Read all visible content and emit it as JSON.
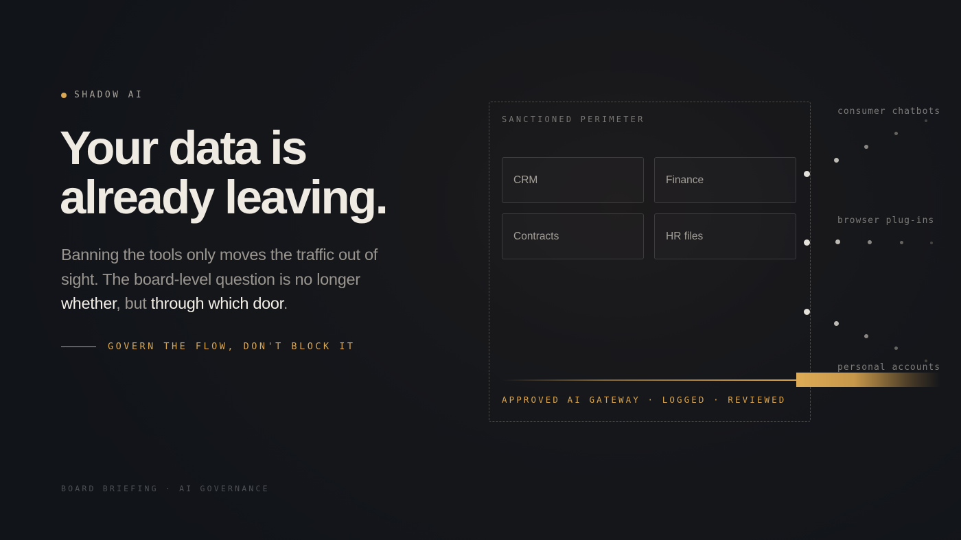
{
  "eyebrow": {
    "label": "SHADOW AI",
    "dot_color": "#d9a651"
  },
  "headline": {
    "line1": "Your data is",
    "line2": "already leaving."
  },
  "lede": {
    "part1": "Banning the tools only moves the traffic out of sight. The board-level question is no longer ",
    "emphasis1": "whether",
    "part2": ", but ",
    "emphasis2": "through which door",
    "part3": "."
  },
  "cta": {
    "label": "GOVERN THE FLOW, DON'T BLOCK IT"
  },
  "footer": {
    "label": "BOARD BRIEFING · AI GOVERNANCE"
  },
  "diagram": {
    "perimeter_label": "SANCTIONED PERIMETER",
    "systems": [
      "CRM",
      "Finance",
      "Contracts",
      "HR files"
    ],
    "gateway_label": "APPROVED AI GATEWAY · LOGGED · REVIEWED",
    "leak_channels": [
      "consumer chatbots",
      "browser plug-ins",
      "personal accounts"
    ]
  },
  "colors": {
    "accent": "#d9a651",
    "background": "#14161b",
    "text_primary": "#efebe3",
    "text_muted": "#9a968f"
  },
  "icons": {
    "bullet": "dot-icon",
    "leak_point": "dot-icon"
  }
}
